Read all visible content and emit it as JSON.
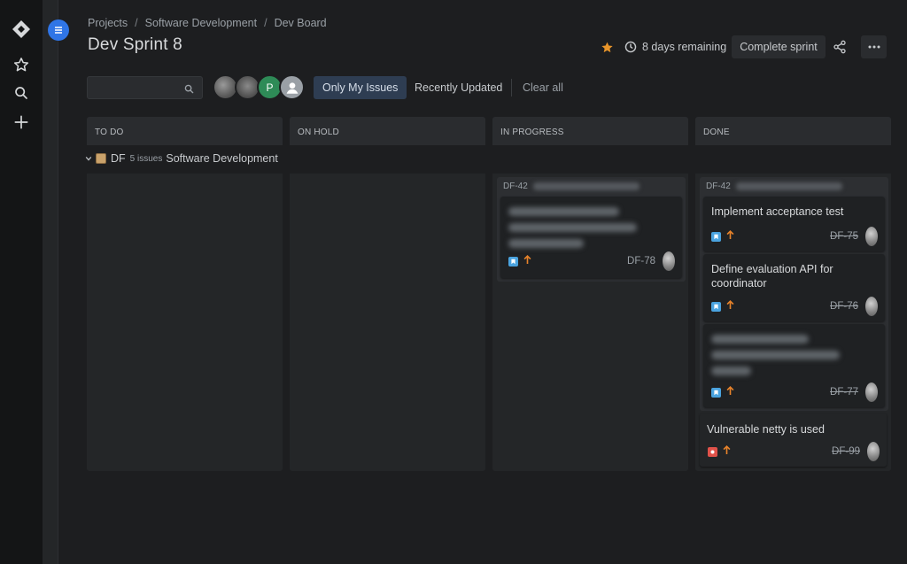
{
  "nav": {
    "icons": [
      "jira-logo-icon",
      "star-icon",
      "search-icon",
      "plus-icon",
      "menu-icon"
    ]
  },
  "breadcrumbs": [
    "Projects",
    "Software Development",
    "Dev Board"
  ],
  "title": "Dev Sprint 8",
  "header": {
    "remaining": "8 days remaining",
    "complete_label": "Complete sprint",
    "favorite_color": "#e8952a"
  },
  "filters": {
    "search_value": "",
    "avatar_p_initial": "P",
    "only_mine": "Only My Issues",
    "recently_updated": "Recently Updated",
    "clear_all": "Clear all"
  },
  "columns": [
    "TO DO",
    "ON HOLD",
    "IN PROGRESS",
    "DONE"
  ],
  "swimlane": {
    "key": "DF",
    "count": "5 issues",
    "project": "Software Development"
  },
  "in_progress": {
    "parent_key": "DF-42",
    "cards": [
      {
        "key": "DF-78",
        "type": "story",
        "done": false
      }
    ]
  },
  "done": {
    "parent_key": "DF-42",
    "cards": [
      {
        "title": "Implement acceptance test",
        "key": "DF-75",
        "type": "story",
        "done": true
      },
      {
        "title": "Define evaluation API for coordinator",
        "key": "DF-76",
        "type": "story",
        "done": true
      },
      {
        "title": "",
        "key": "DF-77",
        "type": "story",
        "done": true
      }
    ],
    "standalone": {
      "title": "Vulnerable netty is used",
      "key": "DF-99",
      "type": "bug",
      "done": true
    }
  }
}
